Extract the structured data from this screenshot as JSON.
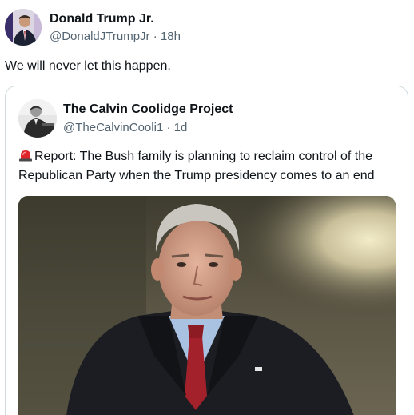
{
  "tweet": {
    "author": {
      "display_name": "Donald Trump Jr.",
      "handle": "@DonaldJTrumpJr",
      "separator": "·",
      "time": "18h"
    },
    "text": "We will never let this happen."
  },
  "quoted_tweet": {
    "author": {
      "display_name": "The Calvin Coolidge Project",
      "handle": "@TheCalvinCooli1",
      "separator": "·",
      "time": "1d"
    },
    "icon": "police-siren-icon",
    "text": "Report: The Bush family is planning to reclaim control of the Republican Party when the Trump presidency comes to an end"
  },
  "colors": {
    "text_primary": "#0f1419",
    "text_secondary": "#536471",
    "border": "#cfd9de",
    "siren_red": "#e0242b"
  }
}
